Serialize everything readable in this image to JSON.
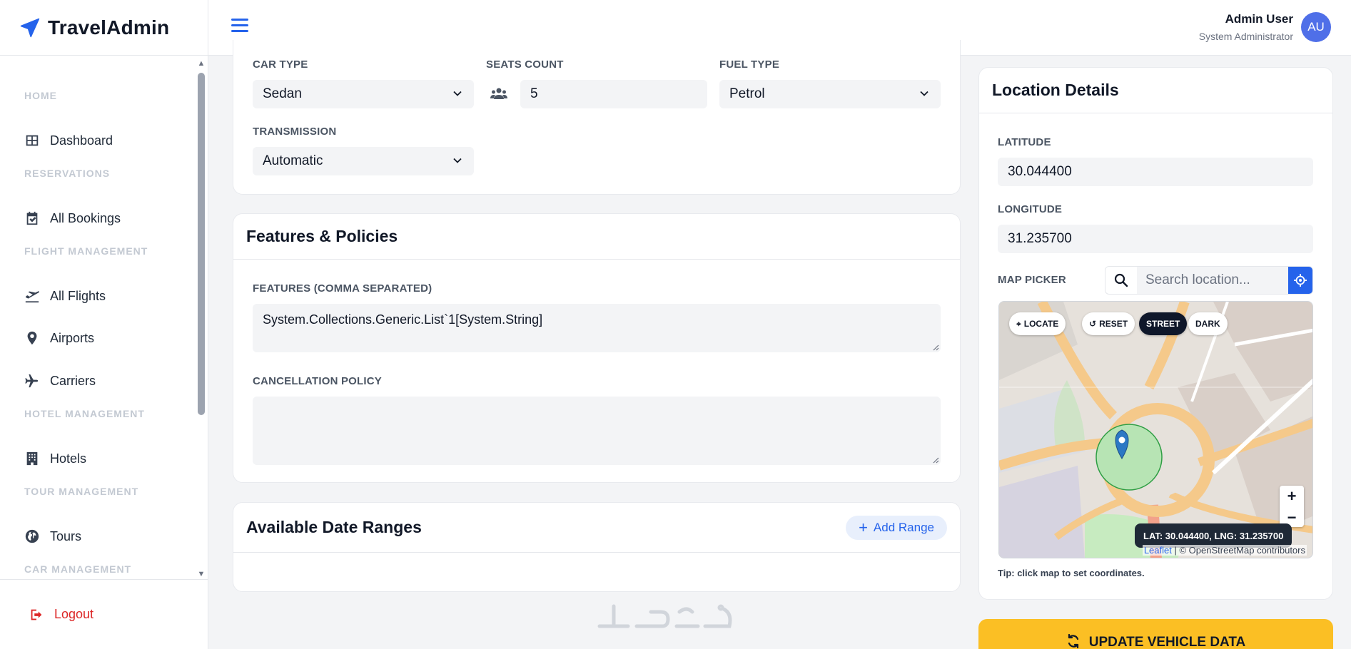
{
  "brand": {
    "name": "TravelAdmin"
  },
  "user": {
    "name": "Admin User",
    "role": "System Administrator",
    "initials": "AU"
  },
  "sidebar": {
    "sections": [
      {
        "title": "HOME",
        "items": [
          {
            "label": "Dashboard",
            "icon": "grid-icon"
          }
        ]
      },
      {
        "title": "RESERVATIONS",
        "items": [
          {
            "label": "All Bookings",
            "icon": "calendar-check-icon"
          }
        ]
      },
      {
        "title": "FLIGHT MANAGEMENT",
        "items": [
          {
            "label": "All Flights",
            "icon": "plane-departure-icon"
          },
          {
            "label": "Airports",
            "icon": "map-pin-icon"
          },
          {
            "label": "Carriers",
            "icon": "plane-icon"
          }
        ]
      },
      {
        "title": "HOTEL MANAGEMENT",
        "items": [
          {
            "label": "Hotels",
            "icon": "building-icon"
          }
        ]
      },
      {
        "title": "TOUR MANAGEMENT",
        "items": [
          {
            "label": "Tours",
            "icon": "globe-icon"
          }
        ]
      },
      {
        "title": "CAR MANAGEMENT",
        "items": []
      }
    ],
    "logout": "Logout"
  },
  "vehicle": {
    "car_type_label": "CAR TYPE",
    "car_type": "Sedan",
    "seats_label": "SEATS COUNT",
    "seats": "5",
    "fuel_label": "FUEL TYPE",
    "fuel": "Petrol",
    "transmission_label": "TRANSMISSION",
    "transmission": "Automatic"
  },
  "features": {
    "title": "Features & Policies",
    "features_label": "FEATURES (COMMA SEPARATED)",
    "features_value": "System.Collections.Generic.List`1[System.String]",
    "cancellation_label": "CANCELLATION POLICY",
    "cancellation_value": ""
  },
  "dates": {
    "title": "Available Date Ranges",
    "add_label": "Add Range"
  },
  "location": {
    "title": "Location Details",
    "latitude_label": "LATITUDE",
    "latitude": "30.044400",
    "longitude_label": "LONGITUDE",
    "longitude": "31.235700",
    "map_picker_label": "MAP PICKER",
    "search_placeholder": "Search location...",
    "buttons": {
      "locate": "LOCATE",
      "reset": "RESET",
      "street": "STREET",
      "dark": "DARK"
    },
    "coords_readout": "LAT: 30.044400, LNG: 31.235700",
    "attribution_leaflet": "Leaflet",
    "attribution_osm": "| © OpenStreetMap contributors",
    "tip": "Tip: click map to set coordinates."
  },
  "update_button": "UPDATE VEHICLE DATA",
  "colors": {
    "accent": "#2563eb",
    "warning": "#fbbf24",
    "danger": "#dc2626"
  }
}
